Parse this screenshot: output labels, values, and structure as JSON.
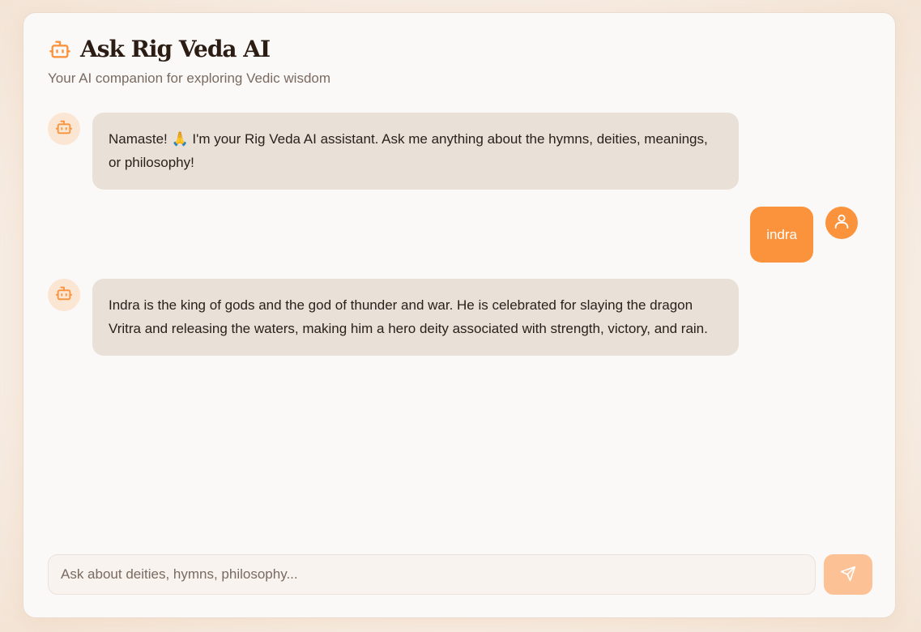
{
  "header": {
    "title": "Ask Rig Veda AI",
    "subtitle": "Your AI companion for exploring Vedic wisdom",
    "icon": "bot-icon"
  },
  "messages": [
    {
      "role": "bot",
      "icon": "bot-icon",
      "text": "Namaste! 🙏 I'm your Rig Veda AI assistant. Ask me anything about the hymns, deities, meanings, or philosophy!"
    },
    {
      "role": "user",
      "icon": "user-icon",
      "text": "indra"
    },
    {
      "role": "bot",
      "icon": "bot-icon",
      "text": "Indra is the king of gods and the god of thunder and war. He is celebrated for slaying the dragon Vritra and releasing the waters, making him a hero deity associated with strength, victory, and rain."
    }
  ],
  "composer": {
    "placeholder": "Ask about deities, hymns, philosophy...",
    "value": "",
    "send_icon": "send-icon"
  },
  "colors": {
    "accent": "#fb923c",
    "accent_disabled": "#fcc296",
    "bot_bubble": "#e9e0d8",
    "bot_avatar_bg": "#fbe5d3",
    "card_bg": "#fbf9f7"
  }
}
